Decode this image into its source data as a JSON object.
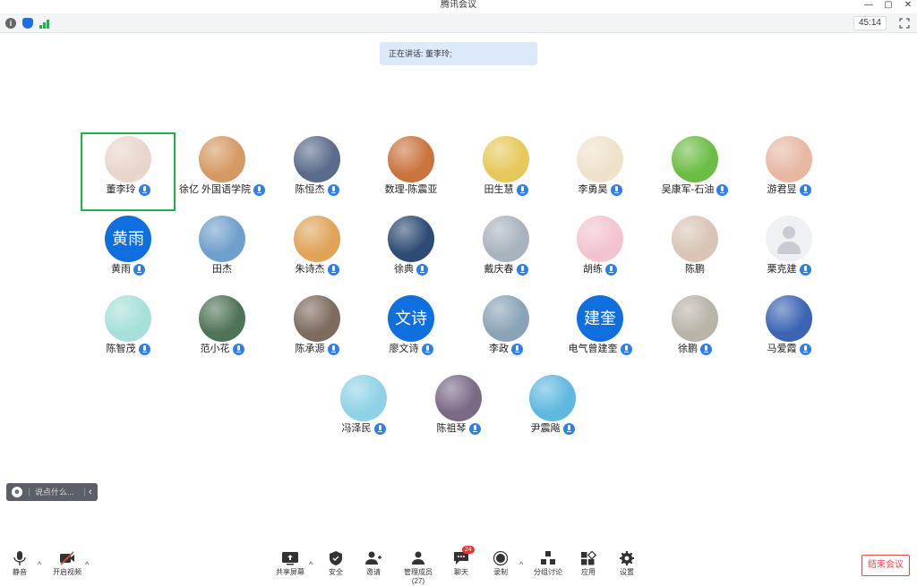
{
  "window": {
    "title": "腾讯会议",
    "min": "—",
    "restore": "▢",
    "close": "✕"
  },
  "infobar": {
    "timer": "45:14"
  },
  "speaking": {
    "label": "正在讲话: 董李玲;"
  },
  "participants": [
    {
      "name": "董李玲",
      "kind": "photo",
      "bg": "#e8d6cc",
      "active": true
    },
    {
      "name": "徐亿 外国语学院",
      "kind": "photo",
      "bg": "#d59a63"
    },
    {
      "name": "陈恒杰",
      "kind": "photo",
      "bg": "#5b6b8a"
    },
    {
      "name": "数理-陈震亚",
      "kind": "photo",
      "bg": "#c9743d",
      "nomic": true
    },
    {
      "name": "田生慧",
      "kind": "photo",
      "bg": "#e6c95a"
    },
    {
      "name": "李勇昊",
      "kind": "photo",
      "bg": "#efe2cc"
    },
    {
      "name": "吴康军-石油",
      "kind": "photo",
      "bg": "#6cbd45"
    },
    {
      "name": "游君昱",
      "kind": "photo",
      "bg": "#e7b8a4"
    },
    {
      "name": "黄雨",
      "kind": "text",
      "text": "黄雨"
    },
    {
      "name": "田杰",
      "kind": "photo",
      "bg": "#6f9fcc",
      "nomic": true
    },
    {
      "name": "朱诗杰",
      "kind": "photo",
      "bg": "#e0a35a"
    },
    {
      "name": "徐典",
      "kind": "photo",
      "bg": "#2d4b73"
    },
    {
      "name": "戴庆春",
      "kind": "photo",
      "bg": "#a9b3bd"
    },
    {
      "name": "胡练",
      "kind": "photo",
      "bg": "#f2c4cf"
    },
    {
      "name": "陈鹏",
      "kind": "photo",
      "bg": "#d9c4b5",
      "nomic": true
    },
    {
      "name": "栗克建",
      "kind": "ghost"
    },
    {
      "name": "陈智茂",
      "kind": "photo",
      "bg": "#a6e0d8"
    },
    {
      "name": "范小花",
      "kind": "photo",
      "bg": "#4f7356"
    },
    {
      "name": "陈承源",
      "kind": "photo",
      "bg": "#7c6b5e"
    },
    {
      "name": "廖文诗",
      "kind": "text",
      "text": "文诗"
    },
    {
      "name": "李政",
      "kind": "photo",
      "bg": "#8aa3b7"
    },
    {
      "name": "电气曾建奎",
      "kind": "text",
      "text": "建奎"
    },
    {
      "name": "徐鹏",
      "kind": "photo",
      "bg": "#b9b3a8"
    },
    {
      "name": "马爱霞",
      "kind": "photo",
      "bg": "#3b64b3"
    },
    {
      "name": "冯泽民",
      "kind": "photo",
      "bg": "#8fd2e6"
    },
    {
      "name": "陈祖琴",
      "kind": "photo",
      "bg": "#7a6a86"
    },
    {
      "name": "尹震飚",
      "kind": "photo",
      "bg": "#5fb8e0"
    }
  ],
  "chat": {
    "placeholder": "说点什么...",
    "collapse": "‹"
  },
  "toolbar": {
    "mute": "静音",
    "video": "开启视频",
    "share": "共享屏幕",
    "security": "安全",
    "invite": "邀请",
    "members": "管理成员(27)",
    "chat": "聊天",
    "chat_badge": "24",
    "record": "录制",
    "breakout": "分组讨论",
    "apps": "应用",
    "settings": "设置",
    "end": "结束会议"
  }
}
